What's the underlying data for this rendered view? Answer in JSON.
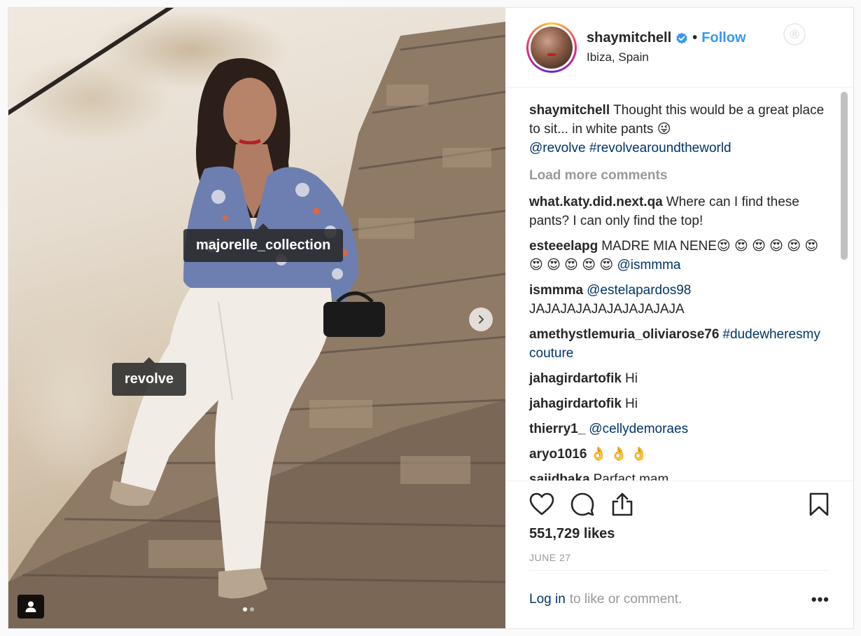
{
  "photo": {
    "tags": [
      "majorelle_collection",
      "revolve"
    ],
    "slide_count": 2,
    "active_slide": 1
  },
  "header": {
    "username": "shaymitchell",
    "follow_label": "Follow",
    "separator": "•",
    "location": "Ibiza, Spain"
  },
  "caption": {
    "username": "shaymitchell",
    "text": "Thought this would be a great place to sit... in white pants 😜",
    "mentions": [
      "@revolve",
      "#revolvearoundtheworld"
    ]
  },
  "load_more": "Load more comments",
  "comments": [
    {
      "user": "what.katy.did.next.qa",
      "text": "Where can I find these pants? I can only find the top!",
      "mention": ""
    },
    {
      "user": "esteeelapg",
      "text": "MADRE MIA NENE😍 😍 😍 😍 😍 😍 😍 😍 😍 😍 😍",
      "mention": "@ismmma"
    },
    {
      "user": "ismmma",
      "text": "JAJAJAJAJAJAJAJAJAJA",
      "mention": "@estelapardos98"
    },
    {
      "user": "amethystlemuria_oliviarose76",
      "text": "",
      "mention": "#dudewheresmycouture"
    },
    {
      "user": "jahagirdartofik",
      "text": "Hi",
      "mention": ""
    },
    {
      "user": "jahagirdartofik",
      "text": "Hi",
      "mention": ""
    },
    {
      "user": "thierry1_",
      "text": "",
      "mention": "@cellydemoraes"
    },
    {
      "user": "aryo1016",
      "text": "👌 👌 👌",
      "mention": ""
    },
    {
      "user": "sajidbaka",
      "text": "Parfact mam",
      "mention": ""
    }
  ],
  "likes": "551,729 likes",
  "date": "JUNE 27",
  "login": {
    "link": "Log in",
    "rest": "to like or comment."
  },
  "more_label": "•••",
  "colors": {
    "accent": "#3897f0",
    "link": "#003569",
    "muted": "#999999"
  }
}
